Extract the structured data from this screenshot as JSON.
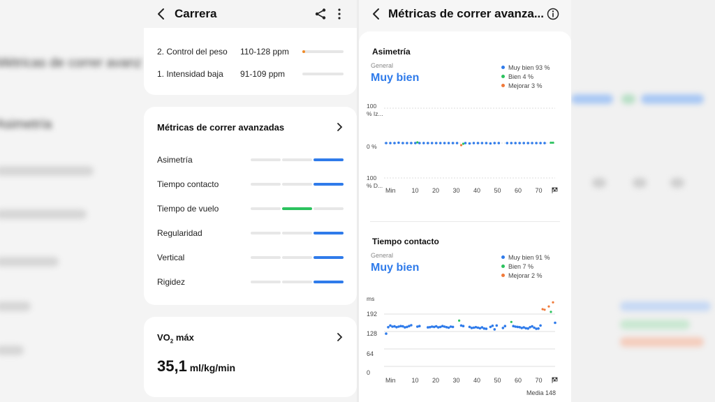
{
  "left_screen": {
    "header": {
      "title": "Carrera"
    },
    "zones": [
      {
        "label": "2. Control del peso",
        "range": "110-128 ppm",
        "level": 0.03
      },
      {
        "label": "1. Intensidad baja",
        "range": "91-109 ppm",
        "level": 0
      }
    ],
    "advanced": {
      "title": "Métricas de correr avanzadas",
      "metrics": [
        {
          "label": "Asimetría",
          "level": 3,
          "color": "#2f7bea"
        },
        {
          "label": "Tiempo contacto",
          "level": 3,
          "color": "#2f7bea"
        },
        {
          "label": "Tiempo de vuelo",
          "level": 2,
          "color": "#2bc25e"
        },
        {
          "label": "Regularidad",
          "level": 3,
          "color": "#2f7bea"
        },
        {
          "label": "Vertical",
          "level": 3,
          "color": "#2f7bea"
        },
        {
          "label": "Rigidez",
          "level": 3,
          "color": "#2f7bea"
        }
      ]
    },
    "vo2": {
      "title_main": "VO",
      "title_sub": "2",
      "title_rest": " máx",
      "value": "35,1",
      "unit": " ml/kg/min"
    }
  },
  "right_screen": {
    "header": {
      "title": "Métricas de correr avanza..."
    },
    "asymmetry": {
      "title": "Asimetría",
      "overall_label": "General",
      "overall_value": "Muy bien",
      "legend": [
        {
          "label": "Muy bien 93 %",
          "color": "#2f7bea"
        },
        {
          "label": "Bien 4 %",
          "color": "#2bc25e"
        },
        {
          "label": "Mejorar 3 %",
          "color": "#f07a3a"
        }
      ],
      "y_labels": {
        "top": "100",
        "top2": "% Iz...",
        "mid": "0 %",
        "bottom": "100",
        "bottom2": "% D..."
      },
      "x_ticks": [
        "Min",
        "10",
        "20",
        "30",
        "40",
        "50",
        "60",
        "70"
      ]
    },
    "contact_time": {
      "title": "Tiempo contacto",
      "overall_label": "General",
      "overall_value": "Muy bien",
      "legend": [
        {
          "label": "Muy bien 91 %",
          "color": "#2f7bea"
        },
        {
          "label": "Bien 7 %",
          "color": "#2bc25e"
        },
        {
          "label": "Mejorar 2 %",
          "color": "#f07a3a"
        }
      ],
      "y_unit": "ms",
      "y_ticks": [
        "192",
        "128",
        "64",
        "0"
      ],
      "x_ticks": [
        "Min",
        "10",
        "20",
        "30",
        "40",
        "50",
        "60",
        "70"
      ],
      "average": "Media 148"
    }
  },
  "chart_data": [
    {
      "type": "scatter",
      "title": "Asimetría",
      "xlabel": "",
      "ylabel": "",
      "x_range": [
        0,
        80
      ],
      "ylim": [
        -100,
        100
      ],
      "series": [
        {
          "name": "Muy bien 93 %",
          "x": [
            0,
            2,
            4,
            6,
            8,
            10,
            12,
            14,
            16,
            18,
            20,
            22,
            24,
            26,
            28,
            30,
            32,
            34,
            38,
            40,
            42,
            44,
            46,
            48,
            50,
            52,
            54,
            58,
            60,
            62,
            64,
            66,
            68,
            70,
            72,
            74,
            76
          ],
          "y": [
            0,
            0,
            0,
            1,
            0,
            0,
            0,
            0,
            0,
            0,
            0,
            0,
            0,
            0,
            0,
            0,
            0,
            0,
            0,
            -1,
            0,
            0,
            0,
            0,
            -1,
            0,
            0,
            0,
            0,
            0,
            0,
            0,
            0,
            0,
            0,
            0,
            0
          ]
        },
        {
          "name": "Bien 4 %",
          "x": [
            15,
            37,
            79,
            80
          ],
          "y": [
            2,
            -2,
            1,
            1
          ]
        },
        {
          "name": "Mejorar 3 %",
          "x": [
            36
          ],
          "y": [
            -6
          ]
        }
      ]
    },
    {
      "type": "scatter",
      "title": "Tiempo contacto",
      "xlabel": "",
      "ylabel": "ms",
      "x_range": [
        0,
        80
      ],
      "ylim": [
        0,
        256
      ],
      "series": [
        {
          "name": "Muy bien 91 %",
          "x": [
            0,
            1,
            2,
            3,
            4,
            5,
            6,
            7,
            8,
            9,
            10,
            11,
            12,
            15,
            16,
            20,
            21,
            22,
            23,
            24,
            25,
            26,
            27,
            28,
            29,
            30,
            31,
            32,
            36,
            37,
            40,
            41,
            42,
            43,
            44,
            45,
            46,
            47,
            48,
            50,
            51,
            52,
            53,
            56,
            57,
            61,
            62,
            63,
            64,
            65,
            66,
            67,
            68,
            69,
            70,
            71,
            72,
            73,
            74,
            81
          ],
          "y": [
            120,
            144,
            150,
            146,
            147,
            144,
            146,
            148,
            147,
            143,
            145,
            148,
            151,
            146,
            148,
            143,
            144,
            146,
            145,
            147,
            143,
            145,
            148,
            146,
            144,
            142,
            146,
            145,
            150,
            148,
            145,
            141,
            142,
            144,
            142,
            140,
            143,
            139,
            138,
            145,
            149,
            136,
            150,
            141,
            148,
            148,
            146,
            145,
            144,
            141,
            143,
            140,
            139,
            144,
            147,
            142,
            138,
            139,
            150,
            160
          ]
        },
        {
          "name": "Bien 7 %",
          "x": [
            35,
            60,
            79
          ],
          "y": [
            168,
            163,
            200
          ]
        },
        {
          "name": "Mejorar 2 %",
          "x": [
            75,
            76,
            78,
            80
          ],
          "y": [
            210,
            208,
            220,
            235
          ]
        }
      ]
    }
  ]
}
